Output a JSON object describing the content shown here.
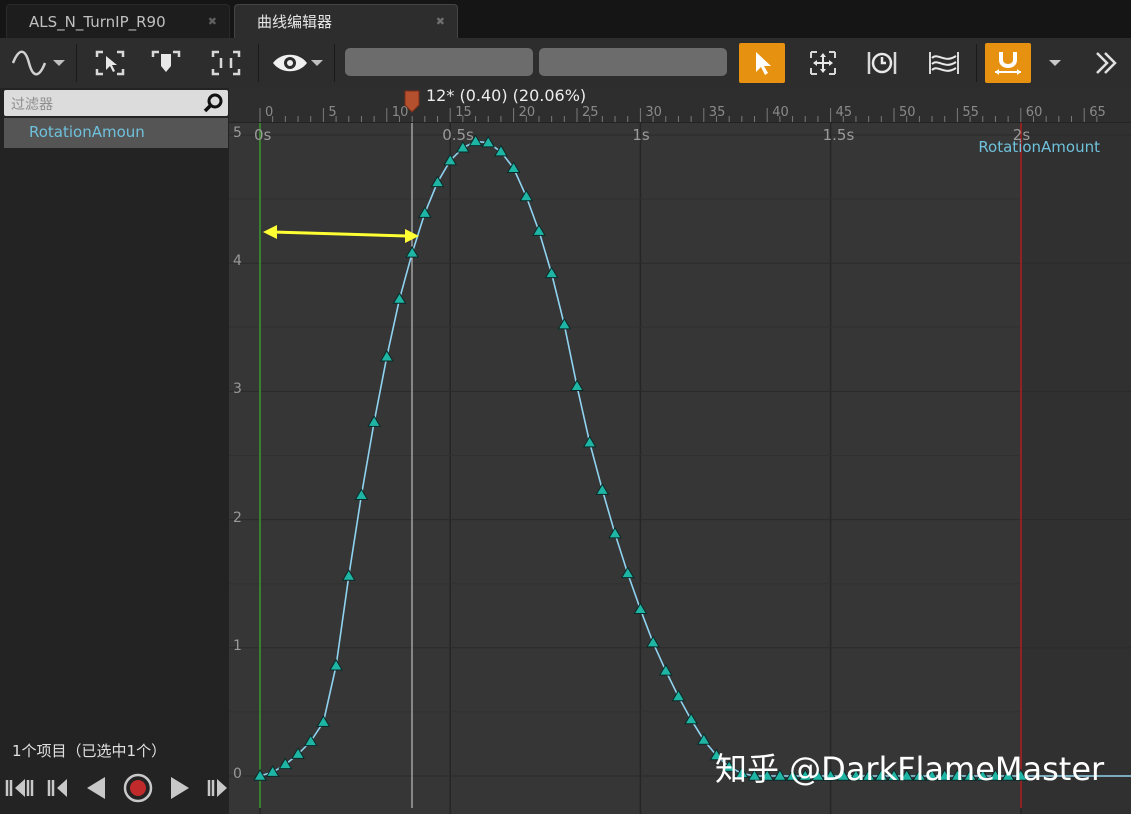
{
  "tabs": [
    {
      "label": "ALS_N_TurnIP_R90"
    },
    {
      "label": "曲线编辑器"
    }
  ],
  "sidebar": {
    "filter_placeholder": "过滤器",
    "curve_item": "RotationAmoun",
    "item_count": "1个项目（已选中1个）"
  },
  "graph": {
    "position_readout": "12* (0.40) (20.06%)",
    "curve_name": "RotationAmount",
    "frame_ticks": [
      "0",
      "5",
      "10",
      "15",
      "20",
      "25",
      "30",
      "35",
      "40",
      "45",
      "50",
      "55",
      "60",
      "65"
    ],
    "time_labels": [
      "0s",
      "0.5s",
      "1s",
      "1.5s",
      "2s"
    ],
    "y_labels": [
      "5",
      "4",
      "3",
      "2",
      "1",
      "0"
    ]
  },
  "watermark": "知乎 @DarkFlameMaster",
  "colors": {
    "accent_orange": "#e79110",
    "curve": "#8fd3f0",
    "key_fill": "#1fb5a5",
    "arrow": "#ffff33",
    "start_marker": "#3d9a2f",
    "end_marker": "#b02020"
  },
  "chart_data": {
    "type": "line",
    "x_unit": "frame",
    "x": [
      0,
      1,
      2,
      3,
      4,
      5,
      6,
      7,
      8,
      9,
      10,
      11,
      12,
      13,
      14,
      15,
      16,
      17,
      18,
      19,
      20,
      21,
      22,
      23,
      24,
      25,
      26,
      27,
      28,
      29,
      30,
      31,
      32,
      33,
      34,
      35,
      36,
      37,
      38,
      39,
      40,
      41,
      42,
      43,
      44,
      45,
      46,
      47,
      48,
      49,
      50,
      51,
      52,
      53,
      54,
      55,
      56,
      57,
      58,
      59,
      60
    ],
    "y": [
      0,
      0.03,
      0.09,
      0.17,
      0.27,
      0.42,
      0.86,
      1.56,
      2.19,
      2.76,
      3.27,
      3.72,
      4.08,
      4.39,
      4.63,
      4.8,
      4.9,
      4.95,
      4.94,
      4.87,
      4.74,
      4.52,
      4.25,
      3.92,
      3.52,
      3.04,
      2.6,
      2.23,
      1.89,
      1.58,
      1.3,
      1.04,
      0.82,
      0.62,
      0.44,
      0.28,
      0.16,
      0.07,
      0.02,
      0,
      0,
      0,
      0,
      0,
      0,
      0,
      0,
      0,
      0,
      0,
      0,
      0,
      0,
      0,
      0,
      0,
      0,
      0,
      0,
      0,
      0
    ],
    "xlim": [
      0,
      60
    ],
    "ylim": [
      0,
      5
    ],
    "current_frame": 12
  }
}
